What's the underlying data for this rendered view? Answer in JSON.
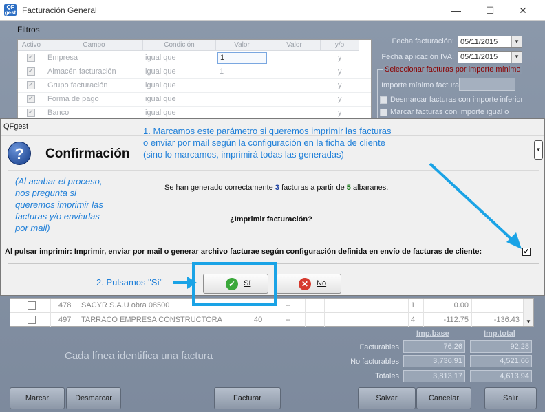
{
  "window": {
    "logo": "QF gest",
    "title": "Facturación General",
    "minimize": "—",
    "maximize": "☐",
    "close": "✕"
  },
  "filters": {
    "title": "Filtros",
    "headers": [
      "Activo",
      "Campo",
      "Condición",
      "Valor",
      "Valor",
      "y/o"
    ],
    "rows": [
      {
        "checked": "✓",
        "campo": "Empresa",
        "condicion": "igual que",
        "valor": "1",
        "yo": "y"
      },
      {
        "checked": "✓",
        "campo": "Almacén facturación",
        "condicion": "igual que",
        "valor": "1",
        "yo": "y"
      },
      {
        "checked": "✓",
        "campo": "Grupo facturación",
        "condicion": "igual que",
        "valor": "",
        "yo": "y"
      },
      {
        "checked": "✓",
        "campo": "Forma de pago",
        "condicion": "igual que",
        "valor": "",
        "yo": "y"
      },
      {
        "checked": "✓",
        "campo": "Banco",
        "condicion": "igual que",
        "valor": "",
        "yo": "y"
      }
    ]
  },
  "side": {
    "fecha_facturacion_label": "Fecha facturación:",
    "fecha_facturacion": "05/11/2015",
    "fecha_iva_label": "Fecha aplicación IVA:",
    "fecha_iva": "05/11/2015",
    "min_box_title": "Seleccionar facturas por importe mínimo",
    "importe_label": "Importe mínimo factura",
    "desmarcar_label": "Desmarcar facturas con importe inferior",
    "marcar_label": "Marcar facturas con importe igual o"
  },
  "dialog": {
    "title": "QFgest",
    "heading": "Confirmación",
    "scroll_glyph": "▼",
    "message_pre": "Se han generado correctamente ",
    "facturas_count": "3",
    "message_mid": " facturas a partir de ",
    "albaranes_count": "5",
    "message_post": " albaranes.",
    "question": "¿Imprimir facturación?",
    "print_option": "Al pulsar imprimir: Imprimir, enviar por mail o generar archivo facturae según configuración definida en envío de facturas de cliente:",
    "print_checked": "✓",
    "yes_label": "Sí",
    "no_label": "No"
  },
  "annotations": {
    "step1_line1": "1. Marcamos este parámetro si queremos imprimir las facturas",
    "step1_line2": "o enviar por mail según la configuración en la ficha de cliente",
    "step1_line3": "(sino lo marcamos, imprimirá todas las generadas)",
    "side_line1": "(Al acabar el proceso,",
    "side_line2": "nos pregunta si",
    "side_line3": "queremos imprimir las",
    "side_line4": "facturas y/o enviarlas",
    "side_line5": "por mail)",
    "step2": "2. Pulsamos \"Sí\"",
    "note": "Cada línea identifica una factura"
  },
  "lower_grid": {
    "rows": [
      {
        "num": "478",
        "nombre": "SACYR S.A.U obra 08500",
        "c1": "",
        "c2": "--",
        "c3": "1",
        "c4": "0.00",
        "c5": ""
      },
      {
        "num": "497",
        "nombre": "TARRACO EMPRESA CONSTRUCTORA",
        "c1": "40",
        "c2": "--",
        "c3": "4",
        "c4": "-112.75",
        "c5": "-136.43"
      }
    ],
    "scroll_glyph": "▼"
  },
  "totals": {
    "head_base": "Imp.base",
    "head_total": "Imp.total",
    "rows": [
      {
        "label": "Facturables",
        "base": "76.26",
        "total": "92.28"
      },
      {
        "label": "No facturables",
        "base": "3,736.91",
        "total": "4,521.66"
      },
      {
        "label": "Totales",
        "base": "3,813.17",
        "total": "4,613.94"
      }
    ]
  },
  "buttons": {
    "marcar": "Marcar",
    "desmarcar": "Desmarcar",
    "facturar": "Facturar",
    "salvar": "Salvar",
    "cancelar": "Cancelar",
    "salir": "Salir"
  }
}
